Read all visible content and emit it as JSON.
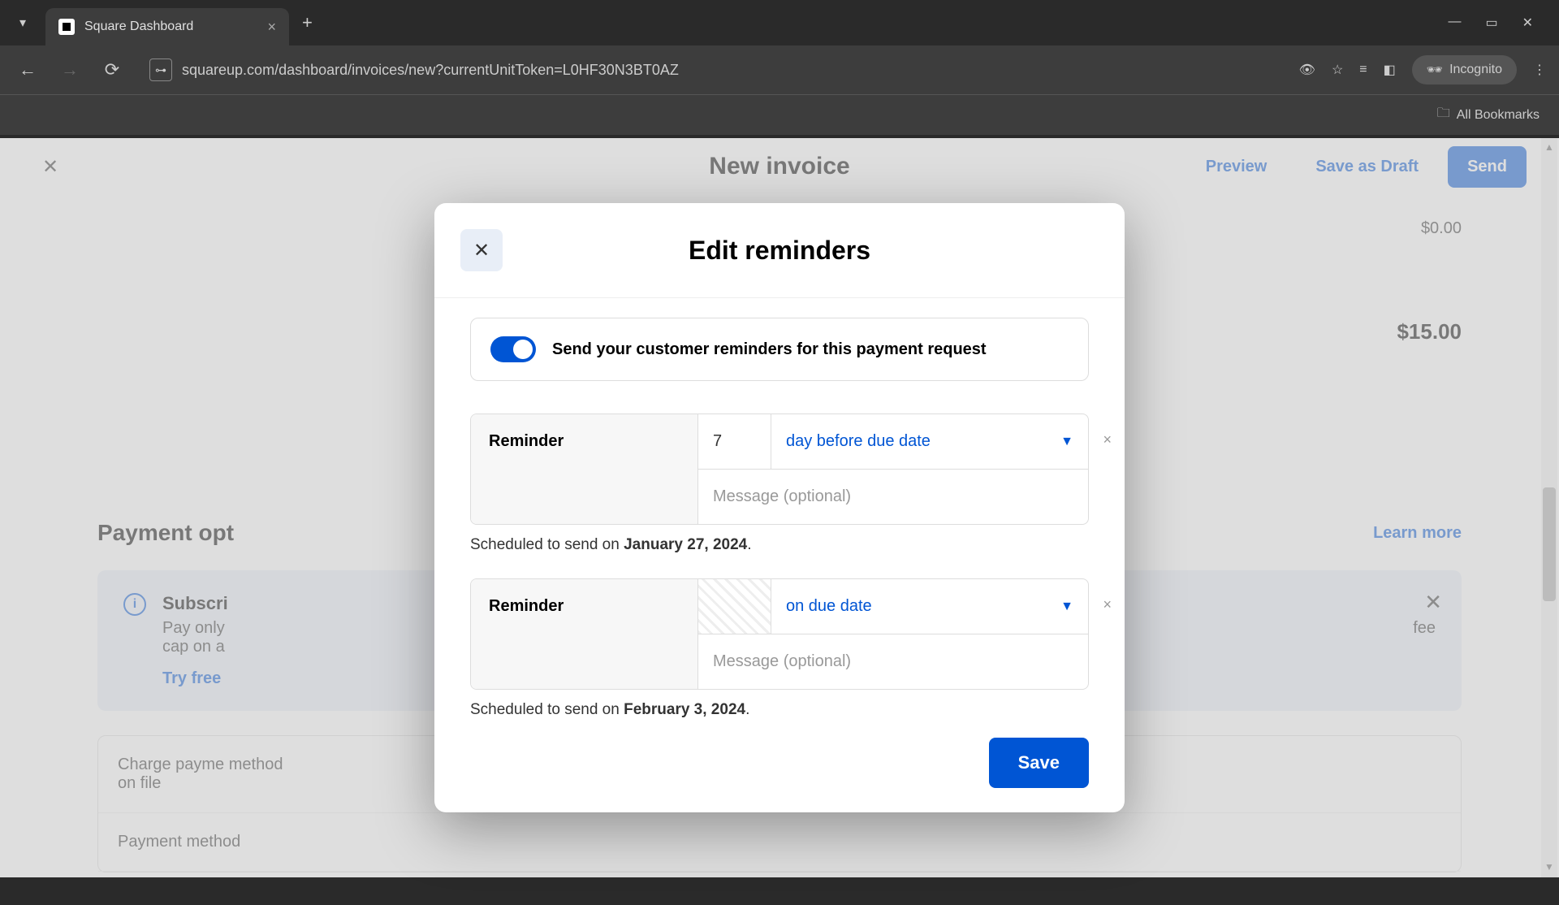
{
  "browser": {
    "tab_title": "Square Dashboard",
    "url": "squareup.com/dashboard/invoices/new?currentUnitToken=L0HF30N3BT0AZ",
    "incognito": "Incognito",
    "all_bookmarks": "All Bookmarks"
  },
  "page": {
    "title": "New invoice",
    "preview": "Preview",
    "save_draft": "Save as Draft",
    "send": "Send",
    "amount_zero": "$0.00",
    "amount_total": "$15.00",
    "section_payment": "Payment opt",
    "learn_more": "Learn more",
    "info_title_prefix": "Subscri",
    "info_body_line1": "Pay only",
    "info_body_suffix": "fee",
    "info_body_line2": "cap on a",
    "try_free": "Try free",
    "charge_label": "Charge payme method on file",
    "payment_method": "Payment method"
  },
  "modal": {
    "title": "Edit reminders",
    "toggle_label": "Send your customer reminders for this payment request",
    "reminder_label": "Reminder",
    "message_placeholder": "Message (optional)",
    "schedule_prefix": "Scheduled to send on ",
    "save": "Save",
    "reminders": [
      {
        "number": "7",
        "timing": "day before due date",
        "date": "January 27, 2024"
      },
      {
        "number": "",
        "timing": "on due date",
        "date": "February 3, 2024"
      }
    ]
  }
}
